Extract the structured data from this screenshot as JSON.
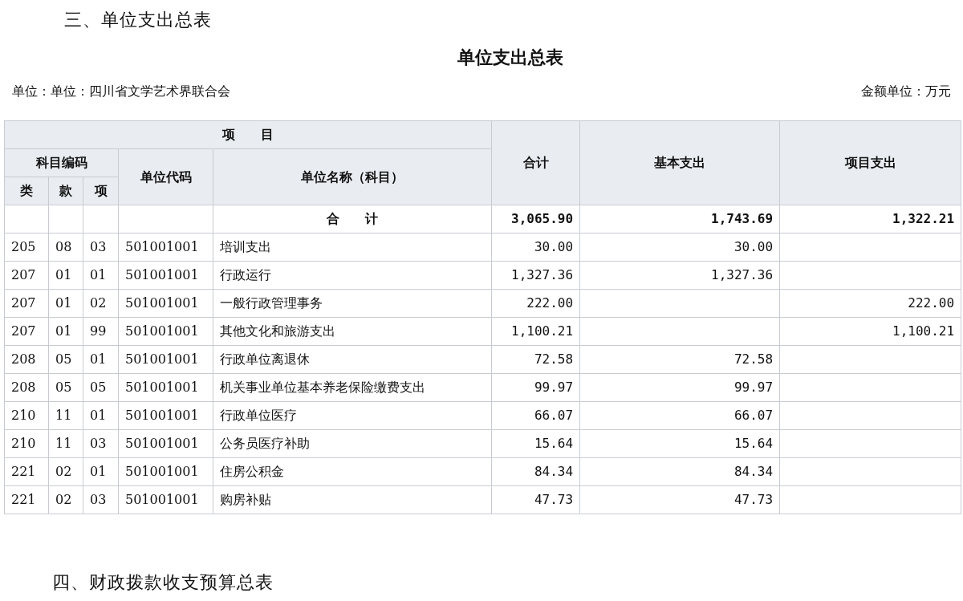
{
  "section_heading": "三、单位支出总表",
  "title": "单位支出总表",
  "unit_label": "单位：单位：四川省文学艺术界联合会",
  "amount_unit": "金额单位：万元",
  "table": {
    "header": {
      "item": "项　　目",
      "subject_code": "科目编码",
      "class": "类",
      "section": "款",
      "item_code": "项",
      "unit_code": "单位代码",
      "unit_name": "单位名称（科目）",
      "total": "合计",
      "basic": "基本支出",
      "project": "项目支出"
    },
    "total_row": {
      "label": "合　　计",
      "total": "3,065.90",
      "basic": "1,743.69",
      "project": "1,322.21"
    },
    "rows": [
      {
        "class": "205",
        "section": "08",
        "item": "03",
        "unit_code": "501001001",
        "name": "培训支出",
        "total": "30.00",
        "basic": "30.00",
        "project": ""
      },
      {
        "class": "207",
        "section": "01",
        "item": "01",
        "unit_code": "501001001",
        "name": "行政运行",
        "total": "1,327.36",
        "basic": "1,327.36",
        "project": ""
      },
      {
        "class": "207",
        "section": "01",
        "item": "02",
        "unit_code": "501001001",
        "name": "一般行政管理事务",
        "total": "222.00",
        "basic": "",
        "project": "222.00"
      },
      {
        "class": "207",
        "section": "01",
        "item": "99",
        "unit_code": "501001001",
        "name": "其他文化和旅游支出",
        "total": "1,100.21",
        "basic": "",
        "project": "1,100.21"
      },
      {
        "class": "208",
        "section": "05",
        "item": "01",
        "unit_code": "501001001",
        "name": "行政单位离退休",
        "total": "72.58",
        "basic": "72.58",
        "project": ""
      },
      {
        "class": "208",
        "section": "05",
        "item": "05",
        "unit_code": "501001001",
        "name": "机关事业单位基本养老保险缴费支出",
        "total": "99.97",
        "basic": "99.97",
        "project": ""
      },
      {
        "class": "210",
        "section": "11",
        "item": "01",
        "unit_code": "501001001",
        "name": "行政单位医疗",
        "total": "66.07",
        "basic": "66.07",
        "project": ""
      },
      {
        "class": "210",
        "section": "11",
        "item": "03",
        "unit_code": "501001001",
        "name": "公务员医疗补助",
        "total": "15.64",
        "basic": "15.64",
        "project": ""
      },
      {
        "class": "221",
        "section": "02",
        "item": "01",
        "unit_code": "501001001",
        "name": "住房公积金",
        "total": "84.34",
        "basic": "84.34",
        "project": ""
      },
      {
        "class": "221",
        "section": "02",
        "item": "03",
        "unit_code": "501001001",
        "name": "购房补贴",
        "total": "47.73",
        "basic": "47.73",
        "project": ""
      }
    ]
  },
  "next_section_heading": "四、财政拨款收支预算总表"
}
